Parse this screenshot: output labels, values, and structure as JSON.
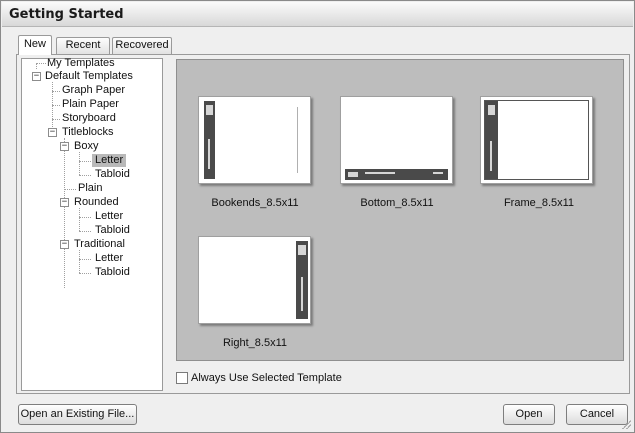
{
  "window": {
    "title": "Getting Started"
  },
  "tabs": [
    {
      "label": "New",
      "active": true
    },
    {
      "label": "Recent",
      "active": false
    },
    {
      "label": "Recovered",
      "active": false
    }
  ],
  "tree": {
    "my_templates": "My Templates",
    "default_templates": "Default Templates",
    "graph_paper": "Graph Paper",
    "plain_paper": "Plain Paper",
    "storyboard": "Storyboard",
    "titleblocks": "Titleblocks",
    "boxy": "Boxy",
    "boxy_letter": "Letter",
    "boxy_tabloid": "Tabloid",
    "plain": "Plain",
    "rounded": "Rounded",
    "rounded_letter": "Letter",
    "rounded_tabloid": "Tabloid",
    "traditional": "Traditional",
    "traditional_letter": "Letter",
    "traditional_tabloid": "Tabloid",
    "selected": "Boxy / Letter"
  },
  "templates": [
    {
      "name": "Bookends_8.5x11"
    },
    {
      "name": "Bottom_8.5x11"
    },
    {
      "name": "Frame_8.5x11"
    },
    {
      "name": "Right_8.5x11"
    }
  ],
  "options": {
    "always_use_label": "Always Use Selected Template",
    "always_use_checked": false
  },
  "buttons": {
    "open_existing": "Open an Existing File...",
    "open": "Open",
    "cancel": "Cancel"
  },
  "colors": {
    "gallery_bg": "#bdbdbd",
    "selection": "#b9b9b9",
    "titleblock_bar": "#4a4a4a"
  }
}
